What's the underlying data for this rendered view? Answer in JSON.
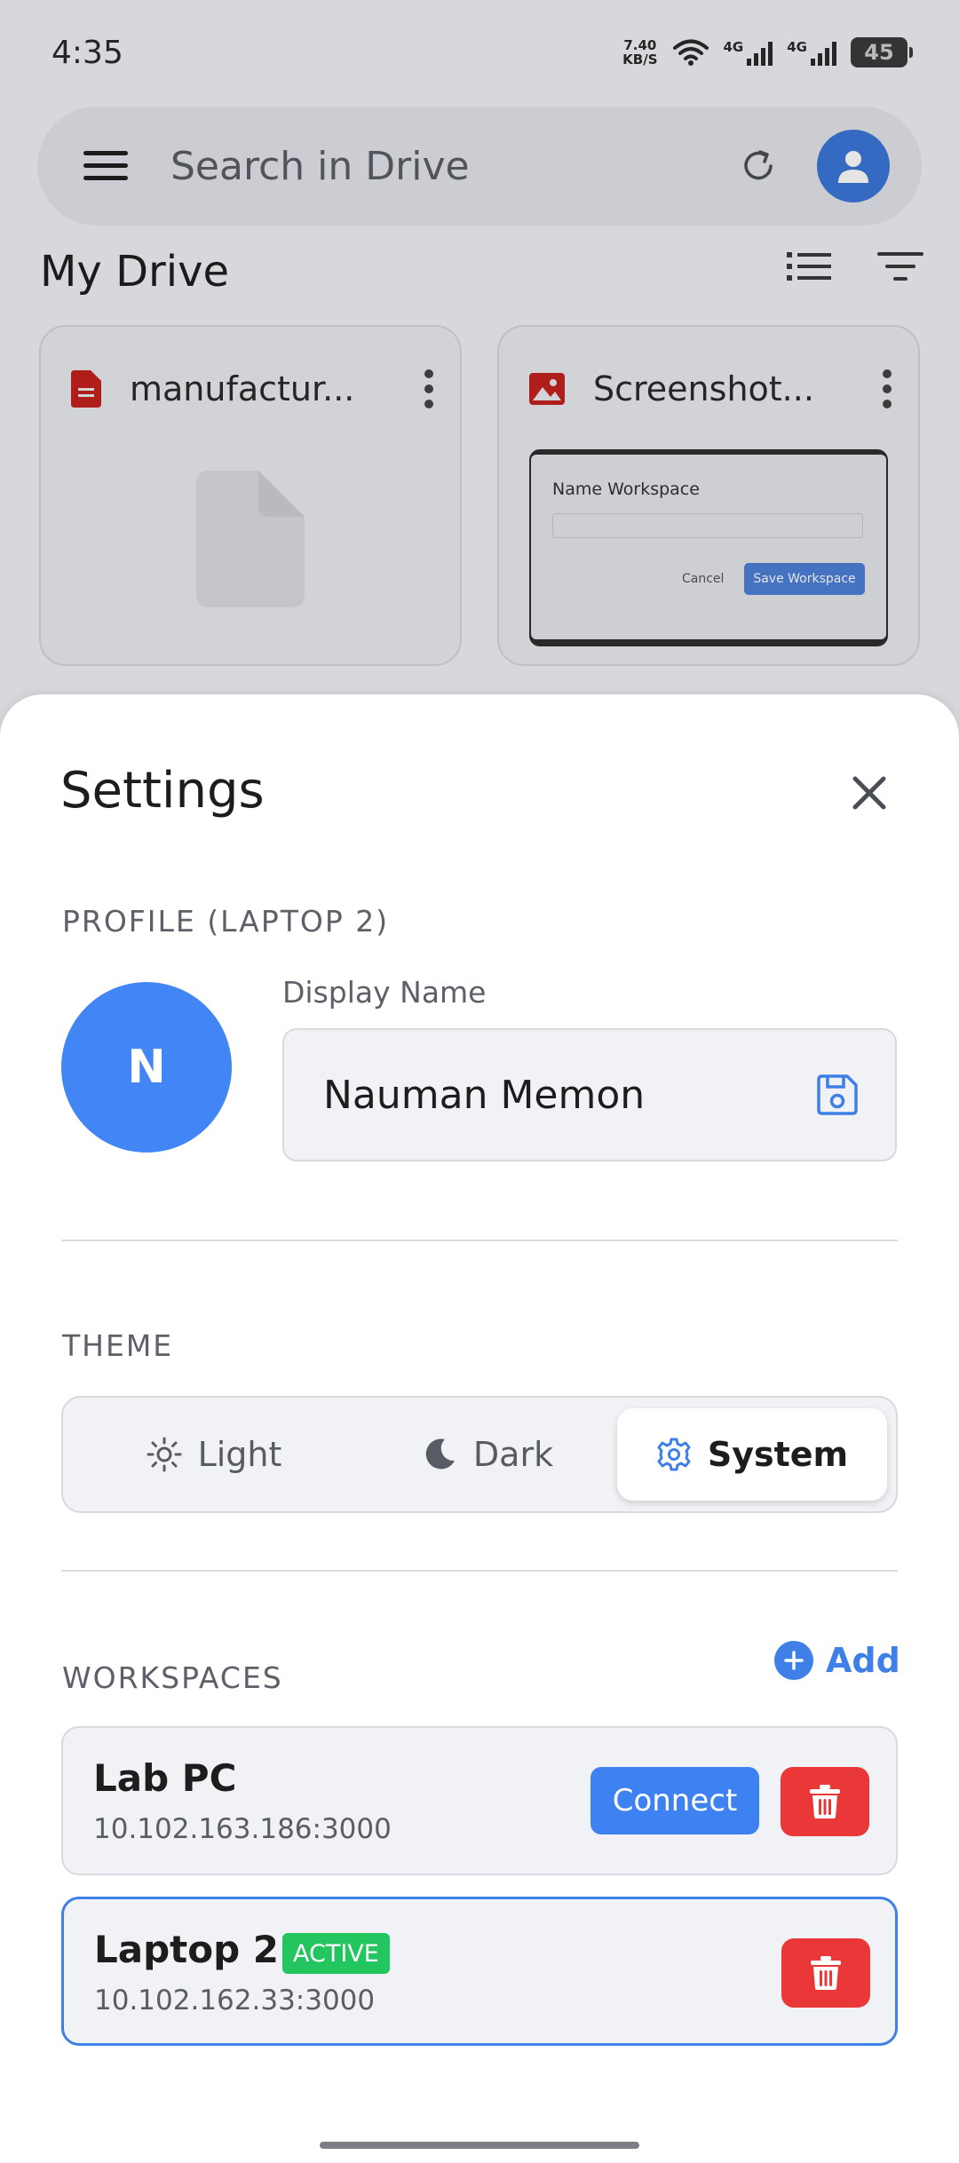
{
  "status_bar": {
    "time": "4:35",
    "net_speed_value": "7.40",
    "net_speed_unit": "KB/S",
    "sim1_label": "4G",
    "sim2_label": "4G",
    "battery": "45"
  },
  "drive": {
    "search_placeholder": "Search in Drive",
    "title": "My Drive",
    "files": [
      {
        "name": "manufactur...",
        "icon": "pdf-file-icon",
        "icon_color": "#c5221f"
      },
      {
        "name": "Screenshot...",
        "icon": "image-file-icon",
        "icon_color": "#c5221f"
      }
    ],
    "screenshot_preview": {
      "title": "Name Workspace",
      "cancel": "Cancel",
      "save": "Save Workspace"
    }
  },
  "settings": {
    "title": "Settings",
    "profile_section": "PROFILE (LAPTOP 2)",
    "avatar_initial": "N",
    "display_name_label": "Display Name",
    "display_name_value": "Nauman Memon",
    "theme_section": "THEME",
    "theme_options": [
      {
        "label": "Light",
        "icon": "sun-icon"
      },
      {
        "label": "Dark",
        "icon": "moon-icon"
      },
      {
        "label": "System",
        "icon": "gear-icon"
      }
    ],
    "theme_selected": "System",
    "workspaces_section": "WORKSPACES",
    "add_label": "Add",
    "workspaces": [
      {
        "name": "Lab PC",
        "address": "10.102.163.186:3000",
        "connect_label": "Connect",
        "active": false
      },
      {
        "name": "Laptop 2",
        "address": "10.102.162.33:3000",
        "badge": "ACTIVE",
        "active": true
      }
    ]
  },
  "colors": {
    "accent": "#3e7fe8",
    "avatar": "#4285f4",
    "danger": "#ea3838",
    "active_badge": "#22c55e"
  }
}
